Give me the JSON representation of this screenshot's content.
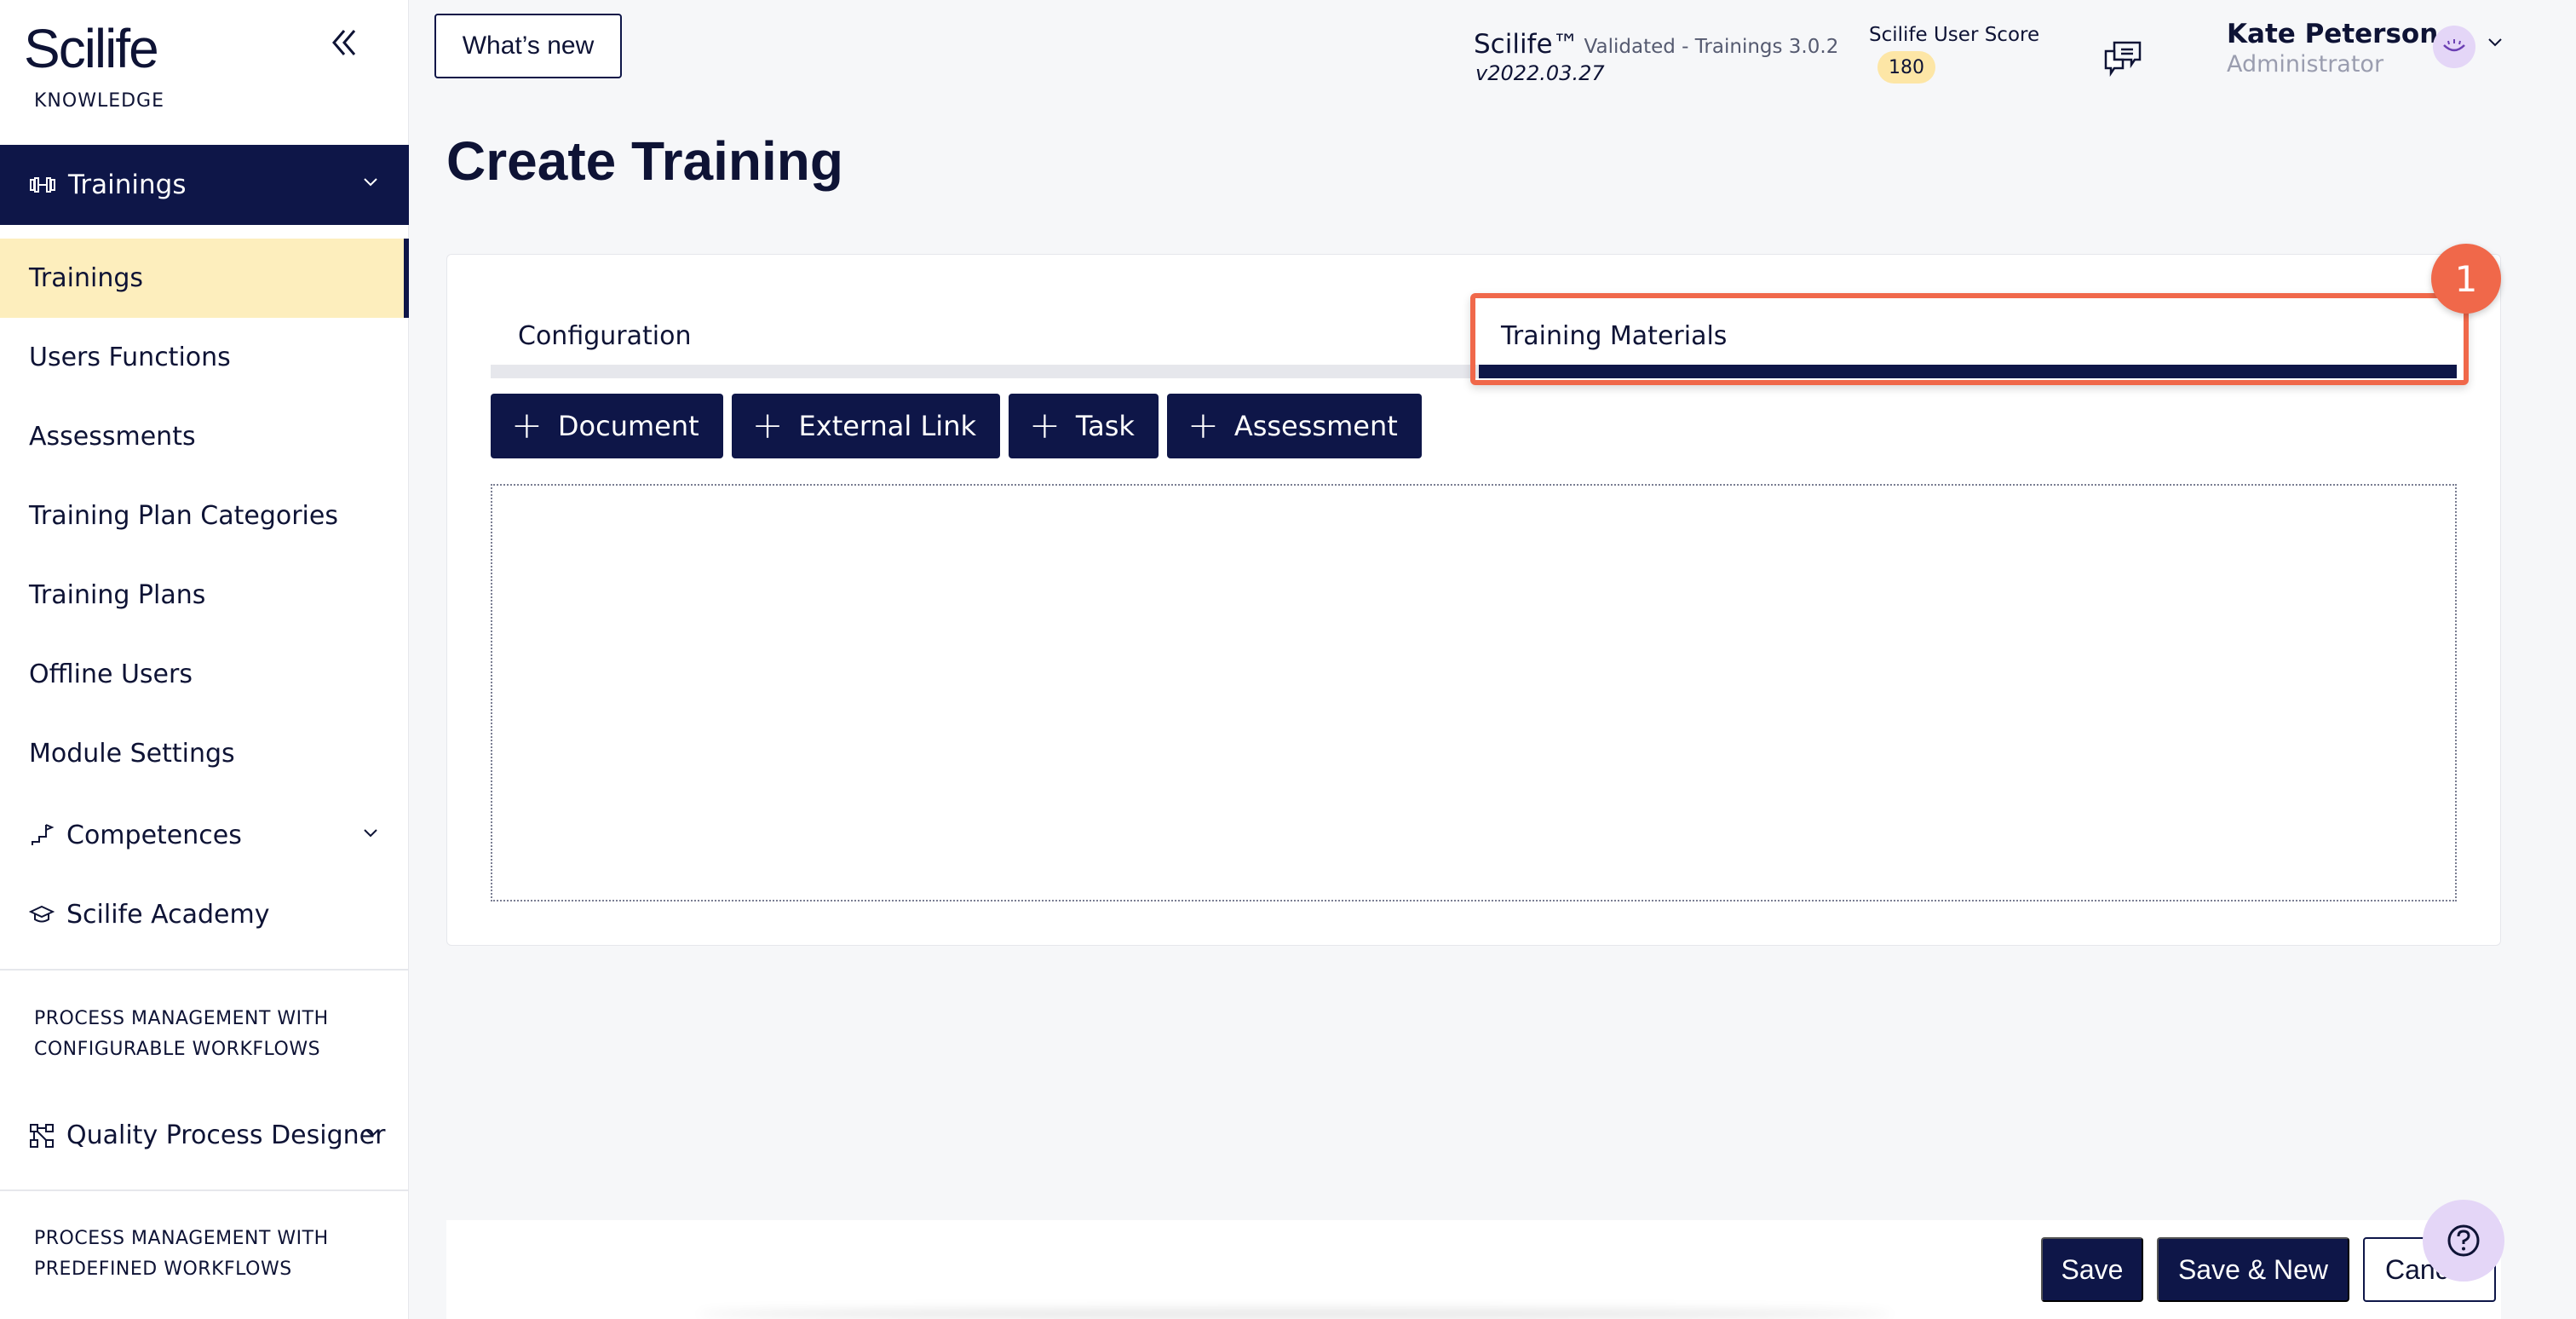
{
  "sidebar": {
    "logo": "Scilife",
    "logo_sub": "KNOWLEDGE",
    "section": {
      "label": "Trainings"
    },
    "items": [
      {
        "label": "Trainings",
        "active": true
      },
      {
        "label": "Users Functions"
      },
      {
        "label": "Assessments"
      },
      {
        "label": "Training Plan Categories"
      },
      {
        "label": "Training Plans"
      },
      {
        "label": "Offline Users"
      },
      {
        "label": "Module Settings"
      }
    ],
    "competences": {
      "label": "Competences"
    },
    "academy": {
      "label": "Scilife Academy"
    },
    "group_configurable": "PROCESS MANAGEMENT WITH CONFIGURABLE WORKFLOWS",
    "quality_designer": {
      "label": "Quality Process Designer"
    },
    "group_predefined": "PROCESS MANAGEMENT WITH PREDEFINED WORKFLOWS"
  },
  "topbar": {
    "whats_new": "What’s new",
    "app_name": "Scilife™",
    "app_validated": "Validated - Trainings 3.0.2",
    "app_version": "v2022.03.27",
    "score_label": "Scilife User Score",
    "score_value": "180",
    "user_name": "Kate Peterson",
    "user_role": "Administrator"
  },
  "main": {
    "title": "Create Training",
    "tabs": [
      {
        "label": "Configuration"
      },
      {
        "label": "Training Materials",
        "active": true
      }
    ],
    "step_badge": "1",
    "toolbar": [
      {
        "label": "Document"
      },
      {
        "label": "External Link"
      },
      {
        "label": "Task"
      },
      {
        "label": "Assessment"
      }
    ]
  },
  "footer": {
    "save": "Save",
    "save_new": "Save & New",
    "cancel": "Cancel"
  },
  "icons": {
    "collapse": "double-chevron-left-icon",
    "trainings": "dumbbell-icon",
    "competences": "flag-icon",
    "academy": "graduation-cap-icon",
    "quality_designer": "workflow-icon",
    "chat": "chat-bubbles-icon",
    "help": "question-icon"
  },
  "colors": {
    "primary": "#0e1648",
    "active_item": "#fdeebd",
    "highlight": "#f0684a",
    "avatar": "#e4d6f7"
  }
}
